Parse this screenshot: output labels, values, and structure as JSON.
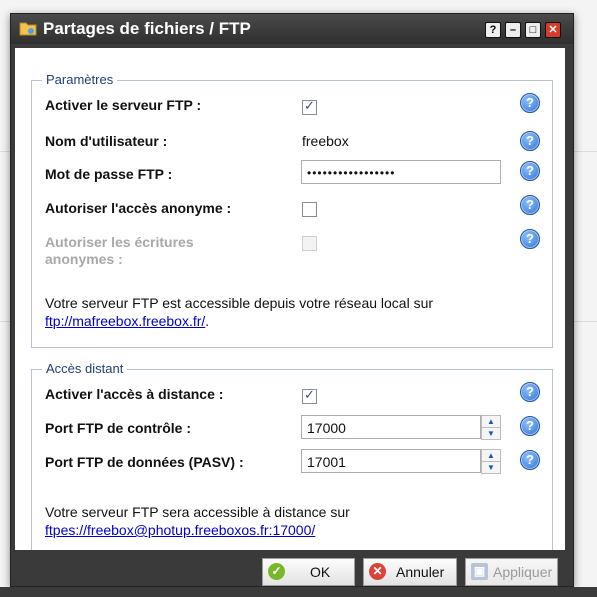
{
  "window": {
    "title": "Partages de fichiers / FTP"
  },
  "titlebar_buttons": {
    "help": "?",
    "minimize": "–",
    "maximize": "□",
    "close": "✕"
  },
  "parametres": {
    "legend": "Paramètres",
    "activer_label": "Activer le serveur FTP :",
    "activer_checked": true,
    "nom_label": "Nom d'utilisateur :",
    "nom_value": "freebox",
    "mdp_label": "Mot de passe FTP :",
    "mdp_value": "•••••••••••••••••",
    "anonyme_label": "Autoriser l'accès anonyme :",
    "anonyme_checked": false,
    "ecritures_label_line1": "Autoriser les écritures",
    "ecritures_label_line2": "anonymes :",
    "ecritures_checked": false,
    "note_text": "Votre serveur FTP est accessible depuis votre réseau local sur",
    "note_link": "ftp://mafreebox.freebox.fr/",
    "note_suffix": "."
  },
  "acces_distant": {
    "legend": "Accès distant",
    "activer_label": "Activer l'accès à distance :",
    "activer_checked": true,
    "port_controle_label": "Port FTP de contrôle :",
    "port_controle_value": "17000",
    "port_donnees_label": "Port FTP de données (PASV) :",
    "port_donnees_value": "17001",
    "note_text": "Votre serveur FTP sera accessible à distance sur",
    "note_link": "ftpes://freebox@photup.freeboxos.fr:17000/"
  },
  "help_icon_glyph": "?",
  "footer": {
    "ok_label": "OK",
    "cancel_label": "Annuler",
    "apply_label": "Appliquer"
  },
  "colors": {
    "titlebar": "#3a3a3a",
    "accent": "#2a6fd0",
    "link": "#0000cc",
    "legend": "#1f3f7a"
  }
}
